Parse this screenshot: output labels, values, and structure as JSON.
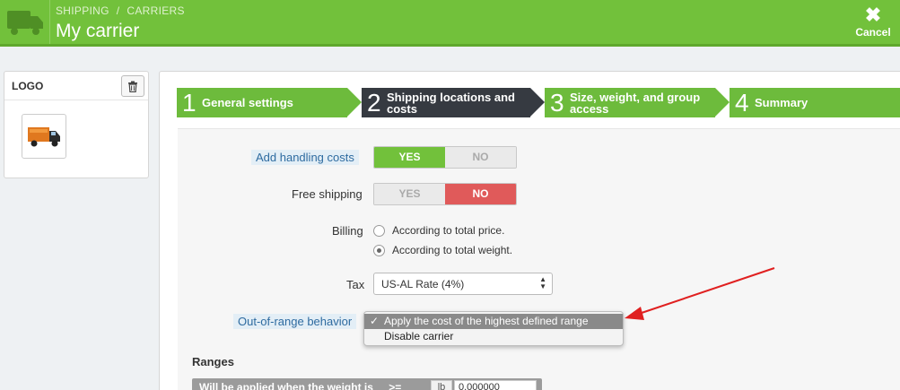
{
  "header": {
    "breadcrumb": [
      "SHIPPING",
      "CARRIERS"
    ],
    "breadcrumb_sep": "/",
    "title": "My carrier",
    "cancel_label": "Cancel",
    "icons": {
      "module": "truck-icon",
      "cancel": "close-icon"
    }
  },
  "logo_panel": {
    "label": "LOGO",
    "icons": {
      "delete": "trash-icon",
      "image": "truck-logo-image"
    }
  },
  "steps": [
    {
      "num": "1",
      "label": "General settings",
      "state": "done"
    },
    {
      "num": "2",
      "label": "Shipping locations and costs",
      "state": "active"
    },
    {
      "num": "3",
      "label": "Size, weight, and group access",
      "state": "todo"
    },
    {
      "num": "4",
      "label": "Summary",
      "state": "todo"
    }
  ],
  "form": {
    "handling": {
      "label": "Add handling costs",
      "yes": "YES",
      "no": "NO",
      "value": "YES"
    },
    "free_shipping": {
      "label": "Free shipping",
      "yes": "YES",
      "no": "NO",
      "value": "NO"
    },
    "billing": {
      "label": "Billing",
      "options": [
        "According to total price.",
        "According to total weight."
      ],
      "selected": "According to total weight."
    },
    "tax": {
      "label": "Tax",
      "value": "US-AL Rate (4%)"
    },
    "out_of_range": {
      "label": "Out-of-range behavior",
      "options": [
        "Apply the cost of the highest defined range",
        "Disable carrier"
      ],
      "selected": "Apply the cost of the highest defined range",
      "check": "✓"
    }
  },
  "ranges": {
    "title": "Ranges",
    "row_label": "Will be applied when the weight is",
    "operator": ">=",
    "unit": "lb",
    "value": "0.000000"
  },
  "colors": {
    "accent": "#72c13b",
    "active_step": "#363a41",
    "no_red": "#e05a5a",
    "annotation_arrow": "#e02020"
  }
}
